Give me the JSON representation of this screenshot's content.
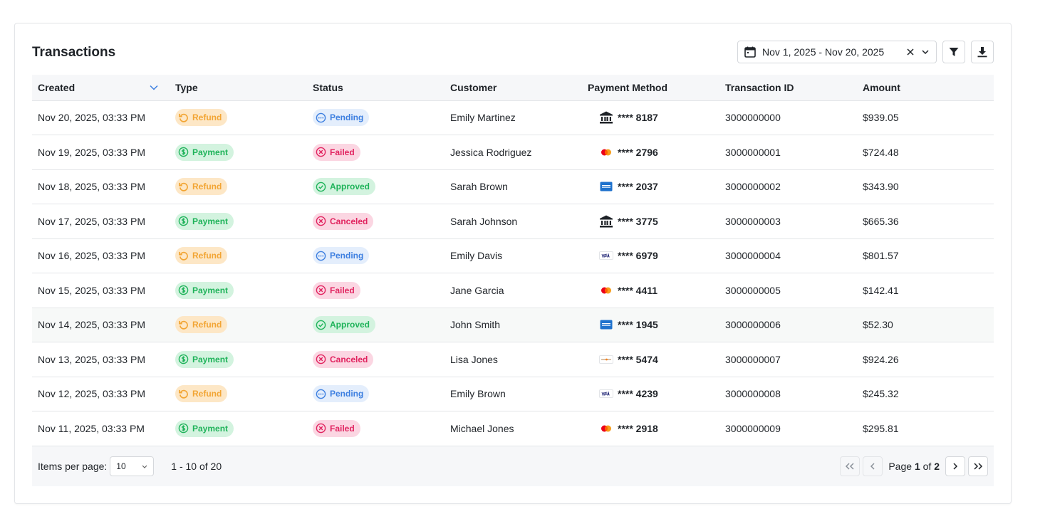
{
  "header": {
    "title": "Transactions",
    "date_range": "Nov 1, 2025 - Nov 20, 2025"
  },
  "table": {
    "columns": [
      "Created",
      "Type",
      "Status",
      "Customer",
      "Payment Method",
      "Transaction ID",
      "Amount"
    ],
    "sorted_column": "Created",
    "rows": [
      {
        "created": "Nov 20, 2025, 03:33 PM",
        "type": "Refund",
        "status": "Pending",
        "customer": "Emily Martinez",
        "method": "bank",
        "card": "**** 8187",
        "txid": "3000000000",
        "amount": "$939.05"
      },
      {
        "created": "Nov 19, 2025, 03:33 PM",
        "type": "Payment",
        "status": "Failed",
        "customer": "Jessica Rodriguez",
        "method": "mastercard",
        "card": "**** 2796",
        "txid": "3000000001",
        "amount": "$724.48"
      },
      {
        "created": "Nov 18, 2025, 03:33 PM",
        "type": "Refund",
        "status": "Approved",
        "customer": "Sarah Brown",
        "method": "amex",
        "card": "**** 2037",
        "txid": "3000000002",
        "amount": "$343.90"
      },
      {
        "created": "Nov 17, 2025, 03:33 PM",
        "type": "Payment",
        "status": "Canceled",
        "customer": "Sarah Johnson",
        "method": "bank",
        "card": "**** 3775",
        "txid": "3000000003",
        "amount": "$665.36"
      },
      {
        "created": "Nov 16, 2025, 03:33 PM",
        "type": "Refund",
        "status": "Pending",
        "customer": "Emily Davis",
        "method": "visa",
        "card": "**** 6979",
        "txid": "3000000004",
        "amount": "$801.57"
      },
      {
        "created": "Nov 15, 2025, 03:33 PM",
        "type": "Payment",
        "status": "Failed",
        "customer": "Jane Garcia",
        "method": "mastercard",
        "card": "**** 4411",
        "txid": "3000000005",
        "amount": "$142.41"
      },
      {
        "created": "Nov 14, 2025, 03:33 PM",
        "type": "Refund",
        "status": "Approved",
        "customer": "John Smith",
        "method": "amex",
        "card": "**** 1945",
        "txid": "3000000006",
        "amount": "$52.30"
      },
      {
        "created": "Nov 13, 2025, 03:33 PM",
        "type": "Payment",
        "status": "Canceled",
        "customer": "Lisa Jones",
        "method": "discover",
        "card": "**** 5474",
        "txid": "3000000007",
        "amount": "$924.26"
      },
      {
        "created": "Nov 12, 2025, 03:33 PM",
        "type": "Refund",
        "status": "Pending",
        "customer": "Emily Brown",
        "method": "visa",
        "card": "**** 4239",
        "txid": "3000000008",
        "amount": "$245.32"
      },
      {
        "created": "Nov 11, 2025, 03:33 PM",
        "type": "Payment",
        "status": "Failed",
        "customer": "Michael Jones",
        "method": "mastercard",
        "card": "**** 2918",
        "txid": "3000000009",
        "amount": "$295.81"
      }
    ]
  },
  "footer": {
    "items_per_page_label": "Items per page:",
    "items_per_page_value": "10",
    "range_text": "1 - 10 of 20",
    "page_prefix": "Page",
    "page_current": "1",
    "page_of": "of",
    "page_total": "2"
  },
  "colors": {
    "refund": "#f2a534",
    "payment": "#1fb35a",
    "pending": "#3d7fe0",
    "failed": "#e1235f"
  }
}
